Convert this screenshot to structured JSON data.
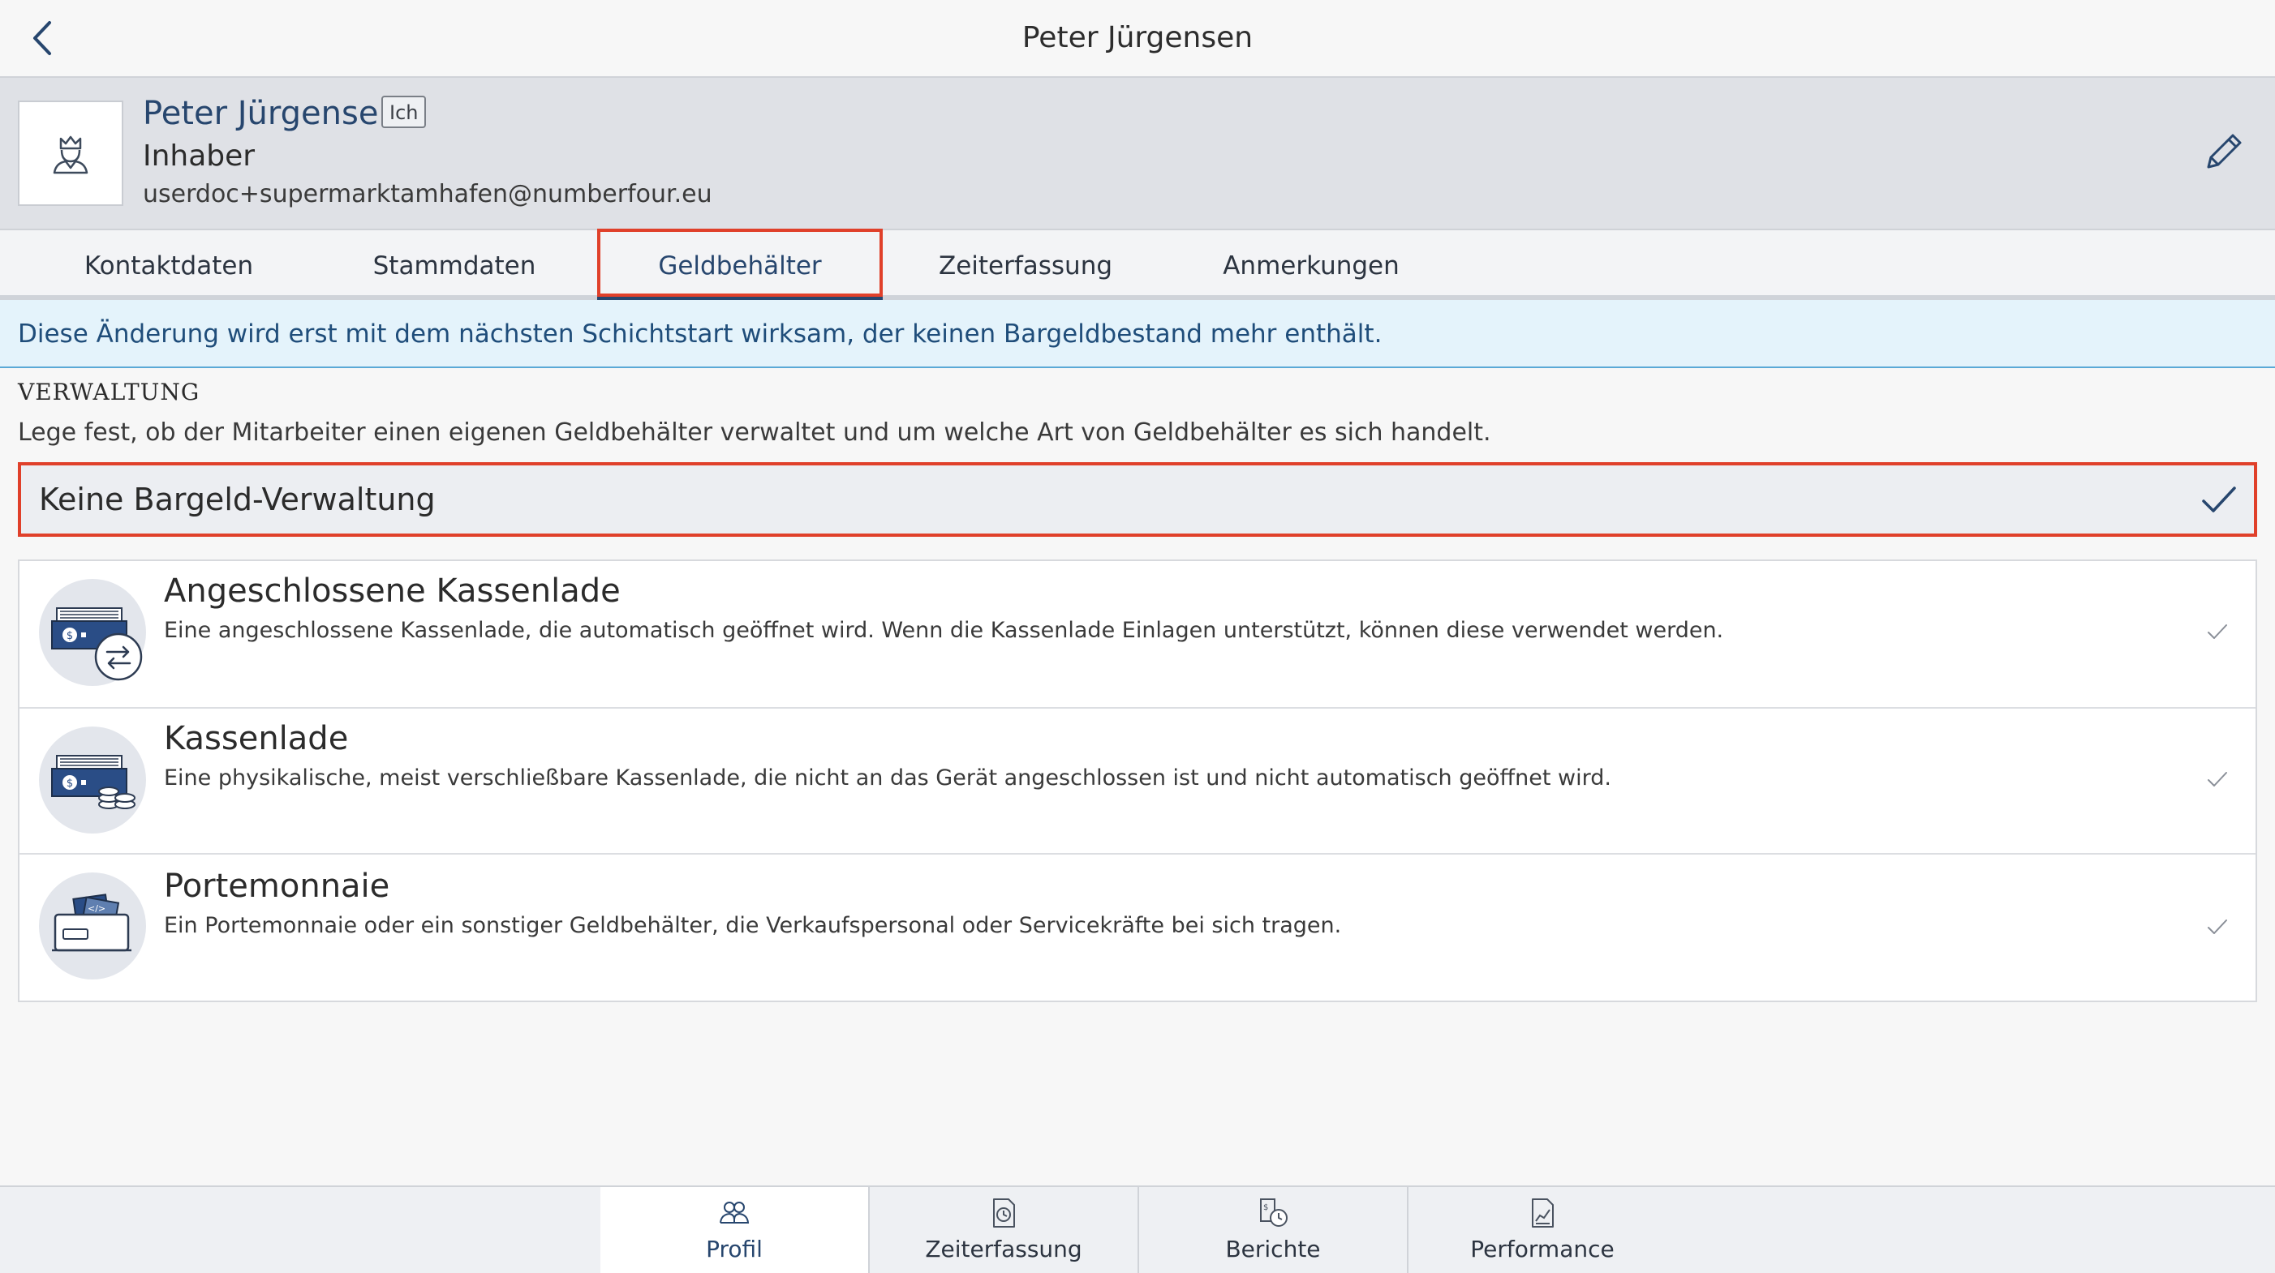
{
  "nav": {
    "title": "Peter Jürgensen"
  },
  "profile": {
    "name": "Peter Jürgensen",
    "badge": "Ich",
    "role": "Inhaber",
    "email": "userdoc+supermarktamhafen@numberfour.eu"
  },
  "tabs": [
    {
      "label": "Kontaktdaten"
    },
    {
      "label": "Stammdaten"
    },
    {
      "label": "Geldbehälter"
    },
    {
      "label": "Zeiterfassung"
    },
    {
      "label": "Anmerkungen"
    }
  ],
  "banner": {
    "text": "Diese Änderung wird erst mit dem nächsten Schichtstart wirksam, der keinen Bargeldbestand mehr enthält."
  },
  "section": {
    "title": "VERWALTUNG",
    "description": "Lege fest, ob der Mitarbeiter einen eigenen Geldbehälter verwaltet und um welche Art von Geldbehälter es sich handelt."
  },
  "selected_option": {
    "label": "Keine Bargeld-Verwaltung"
  },
  "options": [
    {
      "title": "Angeschlossene Kassenlade",
      "description": "Eine angeschlossene Kassenlade, die automatisch geöffnet wird. Wenn die Kassenlade Einlagen unterstützt, können diese verwendet werden.",
      "icon": "connected-cash-drawer-icon"
    },
    {
      "title": "Kassenlade",
      "description": "Eine physikalische, meist verschließbare Kassenlade, die nicht an das Gerät angeschlossen ist und nicht automatisch geöffnet wird.",
      "icon": "cash-drawer-icon"
    },
    {
      "title": "Portemonnaie",
      "description": "Ein Portemonnaie oder ein sonstiger Geldbehälter, die Verkaufspersonal oder Servicekräfte bei sich tragen.",
      "icon": "wallet-icon"
    }
  ],
  "bottom_tabs": [
    {
      "label": "Profil",
      "icon": "people-icon"
    },
    {
      "label": "Zeiterfassung",
      "icon": "timesheet-icon"
    },
    {
      "label": "Berichte",
      "icon": "reports-icon"
    },
    {
      "label": "Performance",
      "icon": "performance-icon"
    }
  ],
  "colors": {
    "brand": "#27466e",
    "highlight": "#e0402a",
    "banner_bg": "#e4f3fb"
  }
}
